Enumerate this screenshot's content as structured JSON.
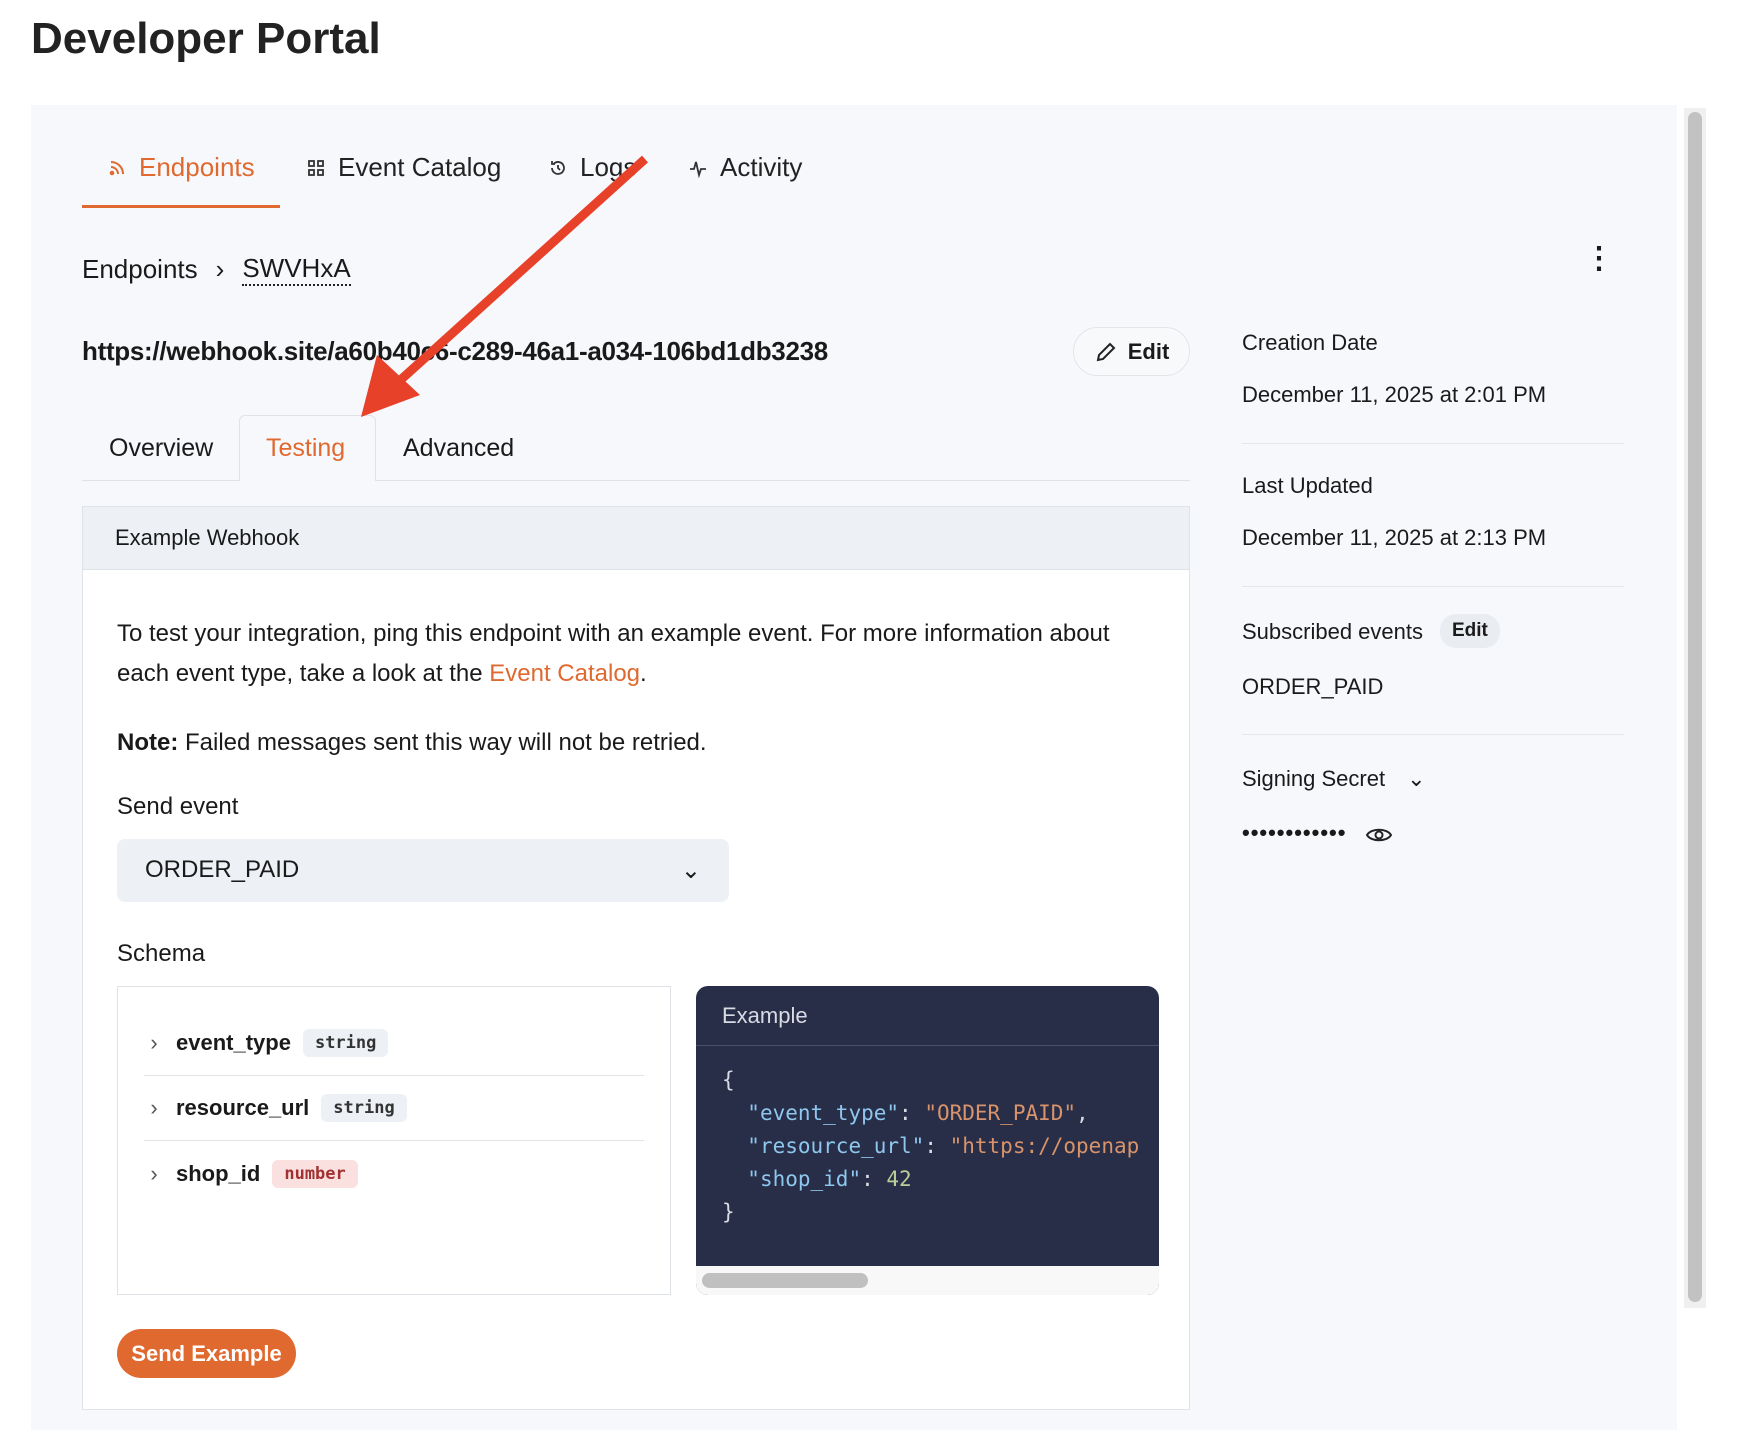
{
  "app_title": "Developer Portal",
  "nav": {
    "tabs": [
      {
        "label": "Endpoints",
        "icon": "rss-icon",
        "active": true
      },
      {
        "label": "Event Catalog",
        "icon": "grid-icon"
      },
      {
        "label": "Logs",
        "icon": "history-icon"
      },
      {
        "label": "Activity",
        "icon": "activity-icon"
      }
    ]
  },
  "breadcrumb": {
    "root": "Endpoints",
    "current": "SWVHxA"
  },
  "endpoint": {
    "url": "https://webhook.site/a60b40c6-c289-46a1-a034-106bd1db3238",
    "edit_label": "Edit"
  },
  "subtabs": [
    {
      "label": "Overview"
    },
    {
      "label": "Testing",
      "active": true
    },
    {
      "label": "Advanced"
    }
  ],
  "card": {
    "header": "Example Webhook",
    "intro": "To test your integration, ping this endpoint with an example event. For more information about each event type, take a look at the ",
    "intro_link": "Event Catalog",
    "intro_end": ".",
    "note_label": "Note:",
    "note_text": " Failed messages sent this way will not be retried.",
    "send_event_label": "Send event",
    "send_event_value": "ORDER_PAID",
    "schema_label": "Schema",
    "schema": [
      {
        "name": "event_type",
        "type": "string"
      },
      {
        "name": "resource_url",
        "type": "string"
      },
      {
        "name": "shop_id",
        "type": "number"
      }
    ],
    "example_title": "Example",
    "example": {
      "open": "{",
      "close": "}",
      "l1k": "\"event_type\"",
      "l1v": "\"ORDER_PAID\"",
      "l2k": "\"resource_url\"",
      "l2v": "\"https://openap",
      "l3k": "\"shop_id\"",
      "l3v": "42"
    },
    "send_button": "Send Example"
  },
  "sidebar": {
    "creation_label": "Creation Date",
    "creation_value": "December 11, 2025 at 2:01 PM",
    "updated_label": "Last Updated",
    "updated_value": "December 11, 2025 at 2:13 PM",
    "subscribed_label": "Subscribed events",
    "subscribed_edit": "Edit",
    "subscribed_value": "ORDER_PAID",
    "secret_label": "Signing Secret",
    "secret_value": "••••••••••••"
  },
  "colors": {
    "accent": "#e0692f",
    "annotation_arrow": "#e8412a",
    "code_bg": "#282e47"
  }
}
